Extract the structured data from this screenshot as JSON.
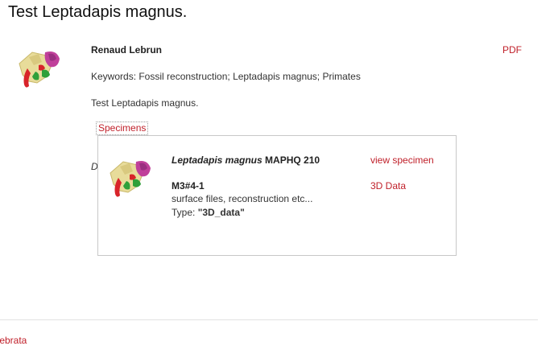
{
  "page": {
    "title": "Test Leptadapis magnus."
  },
  "article": {
    "author": "Renaud Lebrun",
    "pdf_label": "PDF",
    "keywords": "Keywords: Fossil reconstruction; Leptadapis magnus; Primates",
    "description": "Test Leptadapis magnus.",
    "specimens_tab": "Specimens",
    "hidden_text_char": "D"
  },
  "specimen_popup": {
    "species": "Leptadapis magnus",
    "specimen_code": "MAPHQ 210",
    "view_label": "view specimen",
    "id": "M3#4-1",
    "data_label": "3D Data",
    "description": "surface files, reconstruction etc...",
    "type_prefix": "Type: ",
    "type_value": "\"3D_data\""
  },
  "footer": {
    "partial_link": "tebrata"
  },
  "colors": {
    "link": "#c0202a",
    "skull_bone": "#e8dc9a",
    "skull_pink": "#c0409a",
    "skull_green": "#2fa03a",
    "skull_red": "#d8242a"
  },
  "icons": {
    "thumbnail": "skull-reconstruction-icon"
  }
}
